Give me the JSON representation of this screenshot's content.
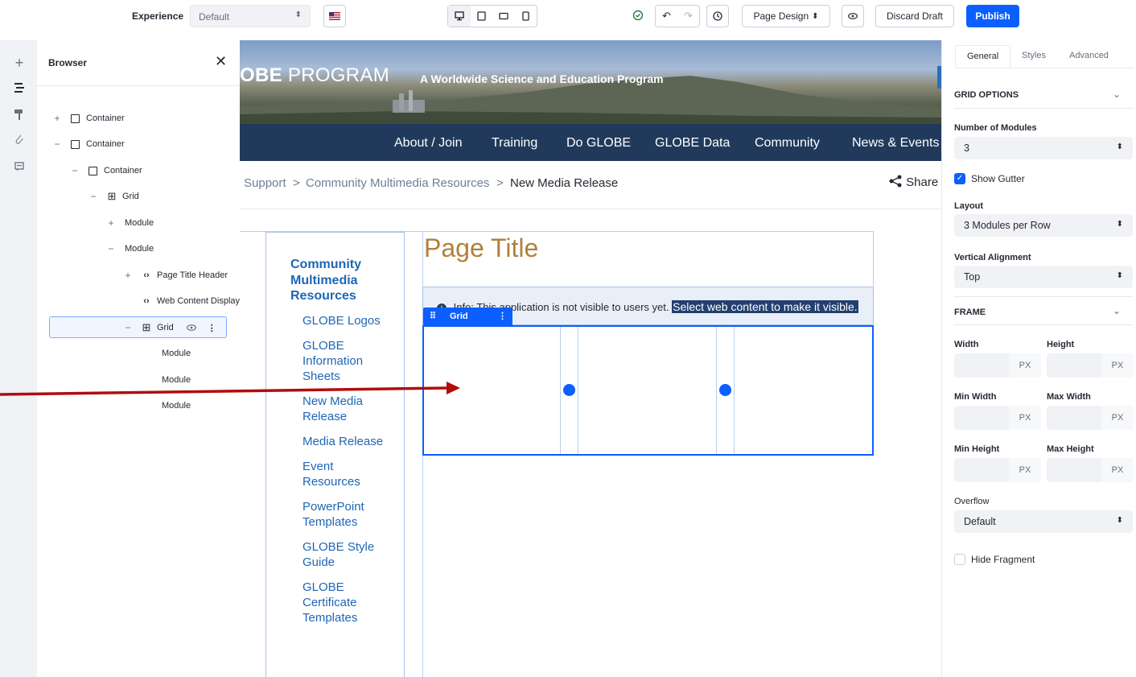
{
  "toolbar": {
    "experience_label": "Experience",
    "experience_value": "Default",
    "page_design": "Page Design",
    "discard": "Discard Draft",
    "publish": "Publish"
  },
  "browser": {
    "title": "Browser",
    "items": [
      {
        "label": "Container"
      },
      {
        "label": "Container"
      },
      {
        "label": "Container"
      },
      {
        "label": "Grid"
      },
      {
        "label": "Module"
      },
      {
        "label": "Module"
      },
      {
        "label": "Page Title Header"
      },
      {
        "label": "Web Content Display"
      },
      {
        "label": "Grid"
      },
      {
        "label": "Module"
      },
      {
        "label": "Module"
      },
      {
        "label": "Module"
      }
    ]
  },
  "site": {
    "logo_bold": "OBE",
    "logo_rest": " PROGRAM",
    "tagline": "A Worldwide Science and Education Program",
    "nav": [
      "About / Join",
      "Training",
      "Do GLOBE",
      "GLOBE Data",
      "Community",
      "News & Events"
    ],
    "breadcrumb": [
      "Support",
      "Community Multimedia Resources",
      "New Media Release"
    ],
    "breadcrumb_sep": ">",
    "share": "Share",
    "side_heading": "Community Multimedia Resources",
    "side_links": [
      "GLOBE Logos",
      "GLOBE Information Sheets",
      "New Media Release",
      "Media Release",
      "Event Resources",
      "PowerPoint Templates",
      "GLOBE Style Guide",
      "GLOBE Certificate Templates"
    ],
    "page_title": "Page Title",
    "info_prefix": "Info:",
    "info_text": "This application is not visible to users yet.",
    "info_highlight": "Select web content to make it visible.",
    "grid_tag": "Grid"
  },
  "panel": {
    "tabs": [
      "General",
      "Styles",
      "Advanced"
    ],
    "grid_options": "GRID OPTIONS",
    "num_modules_label": "Number of Modules",
    "num_modules_value": "3",
    "show_gutter": "Show Gutter",
    "layout_label": "Layout",
    "layout_value": "3 Modules per Row",
    "valign_label": "Vertical Alignment",
    "valign_value": "Top",
    "frame": "FRAME",
    "width": "Width",
    "height": "Height",
    "min_width": "Min Width",
    "max_width": "Max Width",
    "min_height": "Min Height",
    "max_height": "Max Height",
    "px": "PX",
    "overflow_label": "Overflow",
    "overflow_value": "Default",
    "hide_fragment": "Hide Fragment"
  },
  "colors": {
    "accent": "#0b5fff",
    "nav_bg": "#213a5c",
    "link": "#1f66b5",
    "title": "#b1803a",
    "annotation_arrow": "#b10d0d"
  }
}
